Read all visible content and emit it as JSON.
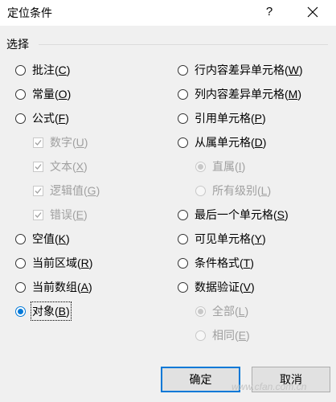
{
  "window": {
    "title": "定位条件",
    "help": "?"
  },
  "group": {
    "label": "选择"
  },
  "left_options": [
    {
      "text": "批注",
      "key": "C"
    },
    {
      "text": "常量",
      "key": "O"
    },
    {
      "text": "公式",
      "key": "F"
    }
  ],
  "formula_sub": [
    {
      "text": "数字",
      "key": "U"
    },
    {
      "text": "文本",
      "key": "X"
    },
    {
      "text": "逻辑值",
      "key": "G"
    },
    {
      "text": "错误",
      "key": "E"
    }
  ],
  "left_options2": [
    {
      "text": "空值",
      "key": "K"
    },
    {
      "text": "当前区域",
      "key": "R"
    },
    {
      "text": "当前数组",
      "key": "A"
    },
    {
      "text": "对象",
      "key": "B"
    }
  ],
  "right_options": [
    {
      "text": "行内容差异单元格",
      "key": "W"
    },
    {
      "text": "列内容差异单元格",
      "key": "M"
    },
    {
      "text": "引用单元格",
      "key": "P"
    },
    {
      "text": "从属单元格",
      "key": "D"
    }
  ],
  "dependents_sub": [
    {
      "text": "直属",
      "key": "I"
    },
    {
      "text": "所有级别",
      "key": "L"
    }
  ],
  "right_options2": [
    {
      "text": "最后一个单元格",
      "key": "S"
    },
    {
      "text": "可见单元格",
      "key": "Y"
    },
    {
      "text": "条件格式",
      "key": "T"
    },
    {
      "text": "数据验证",
      "key": "V"
    }
  ],
  "validation_sub": [
    {
      "text": "全部",
      "key": "L"
    },
    {
      "text": "相同",
      "key": "E"
    }
  ],
  "buttons": {
    "ok": "确定",
    "cancel": "取消"
  },
  "selected": "对象",
  "watermark": "www.cfan.com.cn",
  "colors": {
    "accent": "#0078d7",
    "disabled": "#a0a0a0"
  }
}
